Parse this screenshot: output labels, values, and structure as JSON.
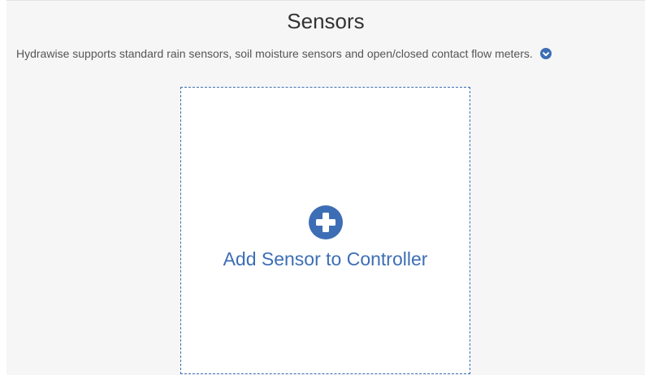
{
  "header": {
    "title": "Sensors"
  },
  "description": {
    "text": "Hydrawise supports standard rain sensors, soil moisture sensors and open/closed contact flow meters.",
    "icon": "info-circle-icon"
  },
  "add_card": {
    "label": "Add Sensor to Controller",
    "icon": "plus-circle-icon"
  },
  "colors": {
    "accent": "#3d6eb5",
    "background": "#f6f6f6",
    "card": "#ffffff",
    "title_text": "#333333",
    "body_text": "#555555"
  }
}
